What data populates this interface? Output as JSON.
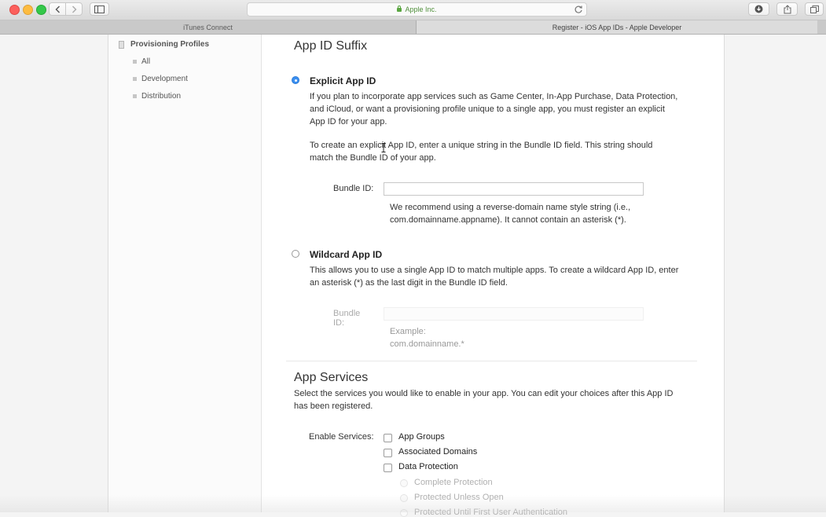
{
  "browser": {
    "address": "Apple Inc.",
    "tabs": [
      "iTunes Connect",
      "Register - iOS App IDs - Apple Developer"
    ]
  },
  "sidebar": {
    "section": "Provisioning Profiles",
    "items": [
      "All",
      "Development",
      "Distribution"
    ]
  },
  "suffix": {
    "heading": "App ID Suffix",
    "explicit": {
      "selected": true,
      "title": "Explicit App ID",
      "desc1": "If you plan to incorporate app services such as Game Center, In-App Purchase, Data Protection, and iCloud, or want a provisioning profile unique to a single app, you must register an explicit App ID for your app.",
      "desc2": "To create an explicit App ID, enter a unique string in the Bundle ID field. This string should match the Bundle ID of your app.",
      "bundle_label": "Bundle ID:",
      "bundle_value": "",
      "hint": "We recommend using a reverse-domain name style string (i.e., com.domainname.appname). It cannot contain an asterisk (*)."
    },
    "wildcard": {
      "selected": false,
      "title": "Wildcard App ID",
      "desc": "This allows you to use a single App ID to match multiple apps. To create a wildcard App ID, enter an asterisk (*) as the last digit in the Bundle ID field.",
      "bundle_label": "Bundle ID:",
      "bundle_value": "",
      "example": "Example: com.domainname.*"
    }
  },
  "services": {
    "heading": "App Services",
    "desc": "Select the services you would like to enable in your app. You can edit your choices after this App ID has been registered.",
    "enable_label": "Enable Services:",
    "items": [
      {
        "label": "App Groups",
        "checked": false
      },
      {
        "label": "Associated Domains",
        "checked": false
      },
      {
        "label": "Data Protection",
        "checked": false
      }
    ],
    "protection_options": [
      "Complete Protection",
      "Protected Unless Open",
      "Protected Until First User Authentication"
    ]
  }
}
